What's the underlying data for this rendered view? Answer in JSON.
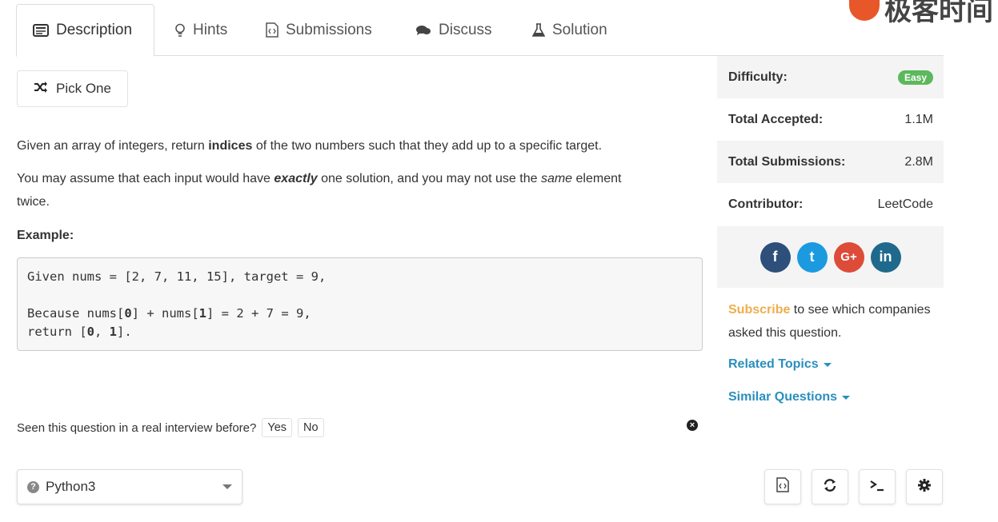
{
  "watermark": {
    "text": "极客时间"
  },
  "tabs": [
    {
      "label": "Description",
      "icon": "description-icon",
      "active": true
    },
    {
      "label": "Hints",
      "icon": "lightbulb-icon",
      "active": false
    },
    {
      "label": "Submissions",
      "icon": "code-file-icon",
      "active": false
    },
    {
      "label": "Discuss",
      "icon": "chat-bubbles-icon",
      "active": false
    },
    {
      "label": "Solution",
      "icon": "flask-icon",
      "active": false
    }
  ],
  "pick_one": {
    "label": "Pick One",
    "icon": "shuffle-icon"
  },
  "problem": {
    "p1_pre": "Given an array of integers, return ",
    "p1_bold": "indices",
    "p1_post": " of the two numbers such that they add up to a specific target.",
    "p2_pre": "You may assume that each input would have ",
    "p2_em": "exactly",
    "p2_mid": " one solution, and you may not use the ",
    "p2_it": "same",
    "p2_post": " element",
    "p2_line2": "twice.",
    "example_label": "Example:",
    "code": {
      "line1": "Given nums = [2, 7, 11, 15], target = 9,",
      "line3_a": "Because nums[",
      "line3_b": "0",
      "line3_c": "] + nums[",
      "line3_d": "1",
      "line3_e": "] = 2 + 7 = 9,",
      "line4_a": "return [",
      "line4_b": "0",
      "line4_c": ", ",
      "line4_d": "1",
      "line4_e": "]."
    }
  },
  "interview": {
    "question": "Seen this question in a real interview before?",
    "yes": "Yes",
    "no": "No"
  },
  "sidebar": {
    "difficulty_label": "Difficulty:",
    "difficulty_value": "Easy",
    "accepted_label": "Total Accepted:",
    "accepted_value": "1.1M",
    "submissions_label": "Total Submissions:",
    "submissions_value": "2.8M",
    "contributor_label": "Contributor:",
    "contributor_value": "LeetCode",
    "social": [
      {
        "icon": "facebook-icon",
        "glyph": "f",
        "color": "#3b5998"
      },
      {
        "icon": "twitter-icon",
        "glyph": "t",
        "color": "#1da1f2"
      },
      {
        "icon": "google-plus-icon",
        "glyph": "G+",
        "color": "#dd4b39"
      },
      {
        "icon": "linkedin-icon",
        "glyph": "in",
        "color": "#0e76a8"
      }
    ],
    "subscribe_link": "Subscribe",
    "subscribe_text": " to see which companies asked this question.",
    "related_topics": "Related Topics",
    "similar_questions": "Similar Questions"
  },
  "editor": {
    "language": "Python3",
    "tools": [
      {
        "icon": "code-file-icon",
        "glyph": "</>"
      },
      {
        "icon": "refresh-icon",
        "glyph": "⟳"
      },
      {
        "icon": "terminal-icon",
        "glyph": ">_"
      },
      {
        "icon": "gear-icon",
        "glyph": "⚙"
      }
    ]
  },
  "colors": {
    "easy": "#5cb85c",
    "link": "#2a8fbd",
    "subscribe": "#f0ad4e"
  }
}
